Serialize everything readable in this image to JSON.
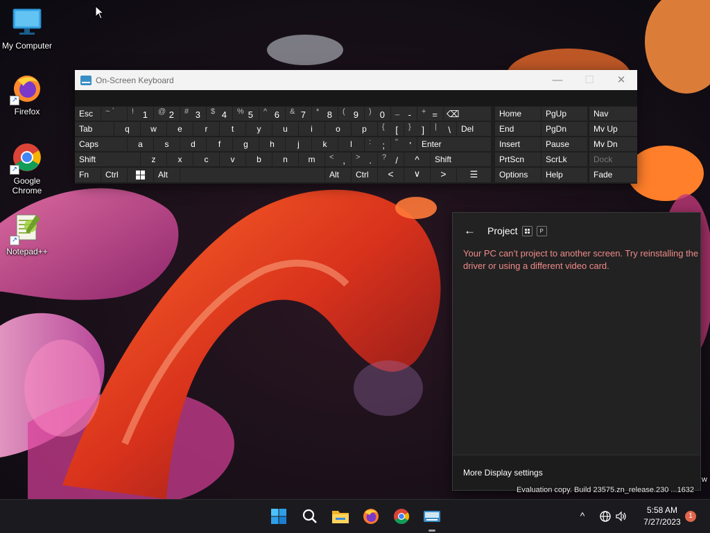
{
  "desktop": {
    "icons": [
      {
        "label": "My Computer",
        "icon": "monitor-icon"
      },
      {
        "label": "Firefox",
        "icon": "firefox-icon"
      },
      {
        "label": "Google Chrome",
        "icon": "chrome-icon"
      },
      {
        "label": "Notepad++",
        "icon": "notepadpp-icon"
      }
    ],
    "watermark": "Evaluation copy. Build 23575.zn_release.230 ...1632",
    "watermark_edge": "w"
  },
  "osk": {
    "title": "On-Screen Keyboard",
    "minimize": "—",
    "maximize": "☐",
    "close": "✕",
    "rows": {
      "r1": {
        "esc": "Esc",
        "k1": {
          "shift": "~ `",
          "main": ""
        },
        "k2": {
          "shift": "!",
          "main": "1"
        },
        "k3": {
          "shift": "@",
          "main": "2"
        },
        "k4": {
          "shift": "#",
          "main": "3"
        },
        "k5": {
          "shift": "$",
          "main": "4"
        },
        "k6": {
          "shift": "%",
          "main": "5"
        },
        "k7": {
          "shift": "^",
          "main": "6"
        },
        "k8": {
          "shift": "&",
          "main": "7"
        },
        "k9": {
          "shift": "*",
          "main": "8"
        },
        "k10": {
          "shift": "(",
          "main": "9"
        },
        "k11": {
          "shift": ")",
          "main": "0"
        },
        "k12": {
          "shift": "_",
          "main": "-"
        },
        "k13": {
          "shift": "+",
          "main": "="
        },
        "bksp": "⌫"
      },
      "r2": {
        "tab": "Tab",
        "letters": [
          "q",
          "w",
          "e",
          "r",
          "t",
          "y",
          "u",
          "i",
          "o",
          "p"
        ],
        "lb": {
          "shift": "{",
          "main": "["
        },
        "rb": {
          "shift": "}",
          "main": "]"
        },
        "bs": {
          "shift": "|",
          "main": "\\"
        },
        "del": "Del"
      },
      "r3": {
        "caps": "Caps",
        "letters": [
          "a",
          "s",
          "d",
          "f",
          "g",
          "h",
          "j",
          "k",
          "l"
        ],
        "semi": {
          "shift": ":",
          "main": ";"
        },
        "quote": {
          "shift": "\"",
          "main": "'"
        },
        "enter": "Enter"
      },
      "r4": {
        "shift": "Shift",
        "letters": [
          "z",
          "x",
          "c",
          "v",
          "b",
          "n",
          "m"
        ],
        "comma": {
          "shift": "<",
          "main": ","
        },
        "period": {
          "shift": ">",
          "main": "."
        },
        "slash": {
          "shift": "?",
          "main": "/"
        },
        "up": "^",
        "rshift": "Shift"
      },
      "r5": {
        "fn": "Fn",
        "ctrl": "Ctrl",
        "alt": "Alt",
        "ralt": "Alt",
        "rctrl": "Ctrl",
        "left": "<",
        "down": "∨",
        "right": ">",
        "menu": "☰"
      }
    },
    "nav": {
      "col1": [
        "Home",
        "End",
        "Insert",
        "PrtScn",
        "Options"
      ],
      "col2": [
        "PgUp",
        "PgDn",
        "Pause",
        "ScrLk",
        "Help"
      ],
      "col3": [
        "Nav",
        "Mv Up",
        "Mv Dn",
        "Dock",
        "Fade"
      ]
    }
  },
  "project": {
    "back": "←",
    "title": "Project",
    "shortcut_key": "P",
    "message": "Your PC can’t project to another screen. Try reinstalling the driver or using a different video card.",
    "footer_link": "More Display settings"
  },
  "taskbar": {
    "apps": [
      "start-icon",
      "search-icon",
      "file-explorer-icon",
      "firefox-icon",
      "chrome-icon",
      "osk-icon"
    ],
    "tray_chevron": "^",
    "time": "5:58 AM",
    "date": "7/27/2023",
    "notification_count": "1"
  }
}
